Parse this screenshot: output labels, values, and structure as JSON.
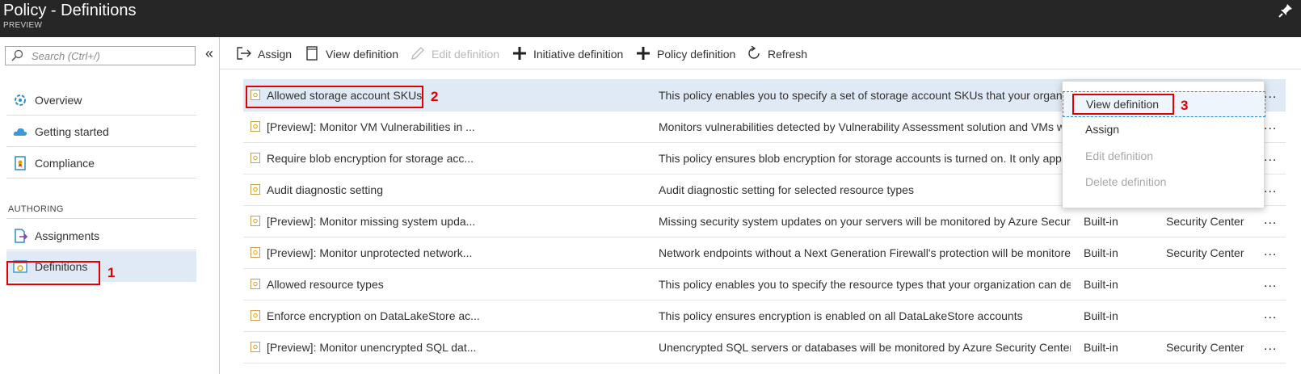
{
  "window": {
    "title": "Policy - Definitions",
    "subtitle": "PREVIEW"
  },
  "sidebar": {
    "search_placeholder": "Search (Ctrl+/)",
    "collapse_glyph": "«",
    "items": [
      {
        "label": "Overview",
        "icon": "overview-icon"
      },
      {
        "label": "Getting started",
        "icon": "cloud-icon"
      },
      {
        "label": "Compliance",
        "icon": "compliance-icon"
      }
    ],
    "section_authoring": "AUTHORING",
    "authoring_items": [
      {
        "label": "Assignments",
        "icon": "assignments-icon"
      },
      {
        "label": "Definitions",
        "icon": "definitions-icon",
        "selected": true
      }
    ]
  },
  "toolbar": {
    "assign": "Assign",
    "view_definition": "View definition",
    "edit_definition": "Edit definition",
    "initiative_definition": "Initiative definition",
    "policy_definition": "Policy definition",
    "refresh": "Refresh"
  },
  "rows": [
    {
      "name": "Allowed storage account SKUs",
      "description": "This policy enables you to specify a set of storage account SKUs that your organizat",
      "type": "",
      "category": "",
      "selected": true
    },
    {
      "name": "[Preview]: Monitor VM Vulnerabilities in ...",
      "description": "Monitors vulnerabilities detected by Vulnerability Assessment solution and VMs wit",
      "type": "",
      "category": ""
    },
    {
      "name": "Require blob encryption for storage acc...",
      "description": "This policy ensures blob encryption for storage accounts is turned on. It only applie",
      "type": "",
      "category": ""
    },
    {
      "name": "Audit diagnostic setting",
      "description": "Audit diagnostic setting for selected resource types",
      "type": "",
      "category": ""
    },
    {
      "name": "[Preview]: Monitor missing system upda...",
      "description": "Missing security system updates on your servers will be monitored by Azure Security ...",
      "type": "Built-in",
      "category": "Security Center"
    },
    {
      "name": "[Preview]: Monitor unprotected network...",
      "description": "Network endpoints without a Next Generation Firewall's protection will be monitored...",
      "type": "Built-in",
      "category": "Security Center"
    },
    {
      "name": "Allowed resource types",
      "description": "This policy enables you to specify the resource types that your organization can depl...",
      "type": "Built-in",
      "category": ""
    },
    {
      "name": "Enforce encryption on DataLakeStore ac...",
      "description": "This policy ensures encryption is enabled on all DataLakeStore accounts",
      "type": "Built-in",
      "category": ""
    },
    {
      "name": "[Preview]: Monitor unencrypted SQL dat...",
      "description": "Unencrypted SQL servers or databases will be monitored by Azure Security Center as ...",
      "type": "Built-in",
      "category": "Security Center"
    }
  ],
  "more_glyph": "...",
  "context_menu": {
    "items": [
      {
        "label": "View definition",
        "focused": true
      },
      {
        "label": "Assign"
      },
      {
        "label": "Edit definition",
        "disabled": true
      },
      {
        "label": "Delete definition",
        "disabled": true
      }
    ]
  },
  "annotations": {
    "step1": "1",
    "step2": "2",
    "step3": "3"
  },
  "colors": {
    "titlebar": "#262626",
    "selection": "#dfeaf6",
    "annotation_red": "#e00000",
    "focus_blue": "#2b88d8"
  }
}
